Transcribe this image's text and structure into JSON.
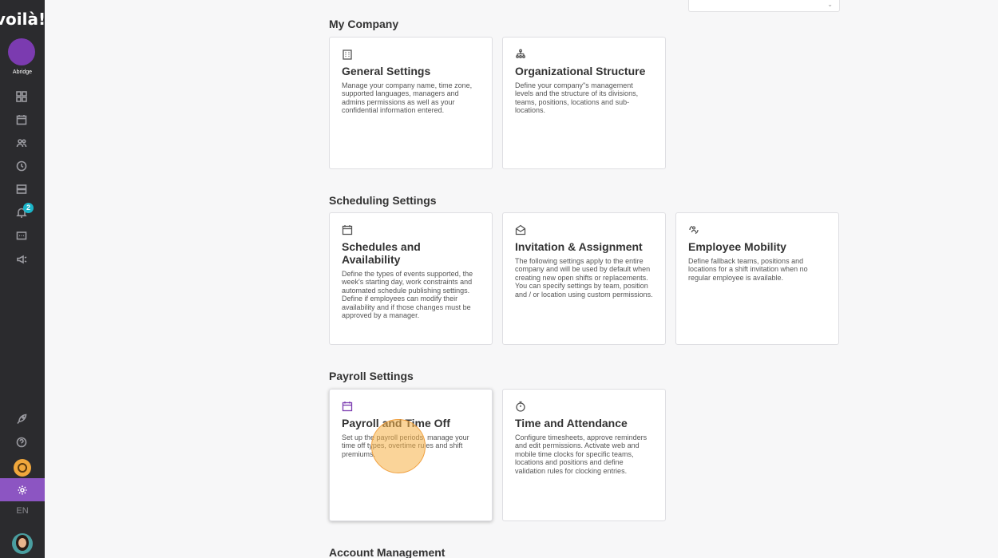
{
  "sidebar": {
    "logo": "voilà!",
    "company_name": "Abridge",
    "notification_count": "2",
    "language": "EN",
    "nav_icons": [
      "dashboard-icon",
      "calendar-icon",
      "people-icon",
      "clock-icon",
      "inbox-icon",
      "bell-icon",
      "chat-icon",
      "megaphone-icon"
    ],
    "bottom_icons": [
      "rocket-icon",
      "help-icon",
      "settings-icon"
    ]
  },
  "sections": {
    "my_company": "My Company",
    "scheduling": "Scheduling Settings",
    "payroll": "Payroll Settings",
    "account": "Account Management"
  },
  "cards": {
    "general": {
      "title": "General Settings",
      "desc": "Manage your company name, time zone, supported languages, managers and admins permissions as well as your confidential information entered."
    },
    "org": {
      "title": "Organizational Structure",
      "desc": "Define your company\"s management levels and the structure of its divisions, teams, positions, locations and sub-locations."
    },
    "schedules": {
      "title": "Schedules and Availability",
      "desc": "Define the types of events supported, the week's starting day, work constraints and automated schedule publishing settings. Define if employees can modify their availability and if those changes must be approved by a manager."
    },
    "invitation": {
      "title": "Invitation & Assignment",
      "desc": "The following settings apply to the entire company and will be used by default when creating new open shifts or replacements. You can specify settings by team, position and / or location using custom permissions."
    },
    "mobility": {
      "title": "Employee Mobility",
      "desc": "Define fallback teams, positions and locations for a shift invitation when no regular employee is available."
    },
    "payroll": {
      "title": "Payroll and Time Off",
      "desc": "Set up the payroll periods, manage your time off types, overtime rules and shift premiums."
    },
    "attendance": {
      "title": "Time and Attendance",
      "desc": "Configure timesheets, approve reminders and edit permissions. Activate web and mobile time clocks for specific teams, locations and positions and define validation rules for clocking entries."
    }
  },
  "colors": {
    "sidebar": "#2b2b2e",
    "accent": "#8c55c2",
    "badge": "#1bb5c9"
  }
}
